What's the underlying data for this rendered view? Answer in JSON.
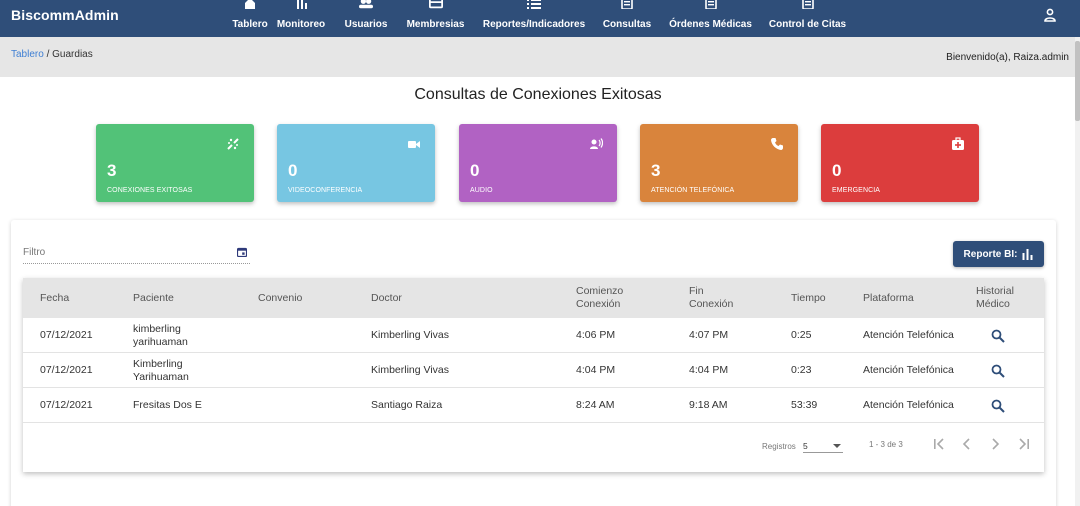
{
  "app": {
    "brand": "BiscommAdmin"
  },
  "nav": [
    {
      "label": "Tablero",
      "icon": "home-icon"
    },
    {
      "label": "Monitoreo",
      "icon": "bar-chart-icon"
    },
    {
      "label": "Usuarios",
      "icon": "users-icon"
    },
    {
      "label": "Membresias",
      "icon": "card-icon"
    },
    {
      "label": "Reportes/Indicadores",
      "icon": "list-icon"
    },
    {
      "label": "Consultas",
      "icon": "document-icon"
    },
    {
      "label": "Órdenes Médicas",
      "icon": "document-icon"
    },
    {
      "label": "Control de Citas",
      "icon": "document-icon"
    }
  ],
  "breadcrumb": {
    "root": "Tablero",
    "separator": " / ",
    "current": "Guardias"
  },
  "welcome": "Bienvenido(a), Raiza.admin",
  "page_title": "Consultas de Conexiones Exitosas",
  "cards": [
    {
      "value": "3",
      "label": "CONEXIONES EXITOSAS",
      "icon": "connection-icon",
      "color": "#52c278"
    },
    {
      "value": "0",
      "label": "VIDEOCONFERENCIA",
      "icon": "video-icon",
      "color": "#77c6e2"
    },
    {
      "value": "0",
      "label": "AUDIO",
      "icon": "speaker-icon",
      "color": "#b162c3"
    },
    {
      "value": "3",
      "label": "ATENCIÓN TELEFÓNICA",
      "icon": "phone-icon",
      "color": "#d9843c"
    },
    {
      "value": "0",
      "label": "EMERGENCIA",
      "icon": "first-aid-icon",
      "color": "#dc3d3d"
    }
  ],
  "filter": {
    "placeholder": "Filtro"
  },
  "report_button": {
    "label": "Reporte BI:"
  },
  "table": {
    "columns": [
      "Fecha",
      "Paciente",
      "Convenio",
      "Doctor",
      "Comienzo Conexión",
      "Fin Conexión",
      "Tiempo",
      "Plataforma",
      "Historial Médico"
    ],
    "rows": [
      {
        "fecha": "07/12/2021",
        "paciente": "kimberling yarihuaman",
        "convenio": "",
        "doctor": "Kimberling Vivas",
        "comienzo": "4:06 PM",
        "fin": "4:07 PM",
        "tiempo": "0:25",
        "plataforma": "Atención Telefónica"
      },
      {
        "fecha": "07/12/2021",
        "paciente": "Kimberling Yarihuaman",
        "convenio": "",
        "doctor": "Kimberling Vivas",
        "comienzo": "4:04 PM",
        "fin": "4:04 PM",
        "tiempo": "0:23",
        "plataforma": "Atención Telefónica"
      },
      {
        "fecha": "07/12/2021",
        "paciente": "Fresitas Dos E",
        "convenio": "",
        "doctor": "Santiago Raiza",
        "comienzo": "8:24 AM",
        "fin": "9:18 AM",
        "tiempo": "53:39",
        "plataforma": "Atención Telefónica"
      }
    ]
  },
  "pager": {
    "label": "Registros",
    "page_size": "5",
    "range": "1 - 3 de 3"
  },
  "colors": {
    "nav_bg": "#2f4e79",
    "link": "#3f7fd3",
    "icon_navy": "#2f4e79"
  }
}
